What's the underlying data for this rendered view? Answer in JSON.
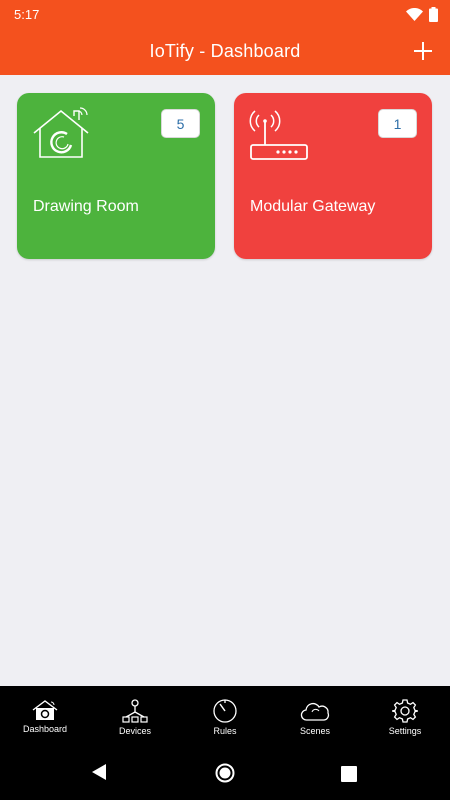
{
  "status_bar": {
    "time": "5:17"
  },
  "app_bar": {
    "title": "IoTify - Dashboard",
    "add_icon": "plus-icon"
  },
  "colors": {
    "header": "#f4511e",
    "room_card": "#4db33d",
    "gateway_card": "#f0413e",
    "background": "#efeff3",
    "badge_text": "#2e6fa8"
  },
  "cards": [
    {
      "label": "Drawing Room",
      "count": "5",
      "icon": "house-icon"
    },
    {
      "label": "Modular Gateway",
      "count": "1",
      "icon": "router-icon"
    }
  ],
  "bottom_nav": [
    {
      "label": "Dashboard",
      "icon": "house-icon",
      "active": true
    },
    {
      "label": "Devices",
      "icon": "devices-icon"
    },
    {
      "label": "Rules",
      "icon": "timer-icon"
    },
    {
      "label": "Scenes",
      "icon": "cloud-icon"
    },
    {
      "label": "Settings",
      "icon": "gear-icon"
    }
  ],
  "system_nav": [
    "back-icon",
    "home-icon",
    "recents-icon"
  ]
}
